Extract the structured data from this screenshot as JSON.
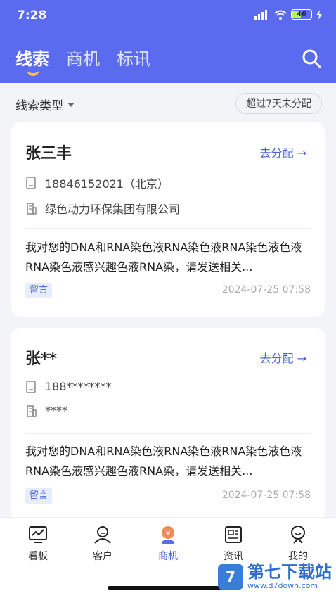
{
  "status": {
    "time": "7:28",
    "battery": "46"
  },
  "tabs": [
    {
      "label": "线索"
    },
    {
      "label": "商机"
    },
    {
      "label": "标讯"
    }
  ],
  "filter": {
    "type_label": "线索类型",
    "chip_label": "超过7天未分配"
  },
  "leads": [
    {
      "name": "张三丰",
      "assign_label": "去分配 →",
      "phone": "18846152021（北京）",
      "company": "绿色动力环保集团有限公司",
      "message": "我对您的DNA和RNA染色液RNA染色液RNA染色液色液RNA染色液感兴趣色液RNA染，请发送相关...",
      "tag": "留言",
      "time": "2024-07-25 07:58"
    },
    {
      "name": "张**",
      "assign_label": "去分配 →",
      "phone": "188********",
      "company": "****",
      "message": "我对您的DNA和RNA染色液RNA染色液RNA染色液色液RNA染色液感兴趣色液RNA染，请发送相关...",
      "tag": "留言",
      "time": "2024-07-25 07:58"
    }
  ],
  "nav": [
    {
      "label": "看板",
      "icon": "dashboard-icon"
    },
    {
      "label": "客户",
      "icon": "customer-icon"
    },
    {
      "label": "商机",
      "icon": "opportunity-icon"
    },
    {
      "label": "资讯",
      "icon": "news-icon"
    },
    {
      "label": "我的",
      "icon": "profile-icon"
    }
  ],
  "watermark": {
    "logo": "7",
    "title": "第七下载站",
    "subtitle": "www.d7down.com"
  },
  "colors": {
    "primary": "#5a6bf0",
    "accent": "#4a63d8",
    "indicator": "#f4c24b"
  }
}
